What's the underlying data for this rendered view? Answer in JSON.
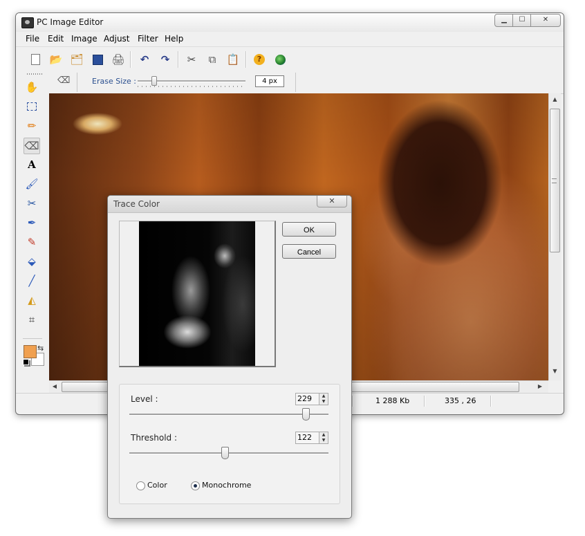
{
  "window": {
    "title": "PC Image Editor"
  },
  "menu": [
    "File",
    "Edit",
    "Image",
    "Adjust",
    "Filter",
    "Help"
  ],
  "toolbar": {
    "icons": [
      "new-document-icon",
      "open-folder-icon",
      "browse-icon",
      "save-icon",
      "print-icon",
      "undo-icon",
      "redo-icon",
      "cut-icon",
      "copy-icon",
      "paste-icon",
      "help-icon",
      "web-icon"
    ]
  },
  "tools": [
    "hand-icon",
    "selection-icon",
    "pencil-icon",
    "eraser-icon",
    "text-icon",
    "brush-icon",
    "clone-icon",
    "airbrush-icon",
    "eyedropper-icon",
    "fill-icon",
    "line-icon",
    "shapes-icon",
    "crop-icon"
  ],
  "options_bar": {
    "erase_size_label": "Erase Size :",
    "erase_size_value": "4 px",
    "erase_size_slider": 0.15
  },
  "status": {
    "file_size": "1 288 Kb",
    "coordinates": "335 , 26"
  },
  "colors": {
    "primary": "#f0a050",
    "secondary": "#ffffff"
  },
  "dialog": {
    "title": "Trace Color",
    "ok_label": "OK",
    "cancel_label": "Cancel",
    "level_label": "Level :",
    "level_value": "229",
    "threshold_label": "Threshold :",
    "threshold_value": "122",
    "color_option": "Color",
    "monochrome_option": "Monochrome",
    "selected_mode": "Monochrome"
  }
}
